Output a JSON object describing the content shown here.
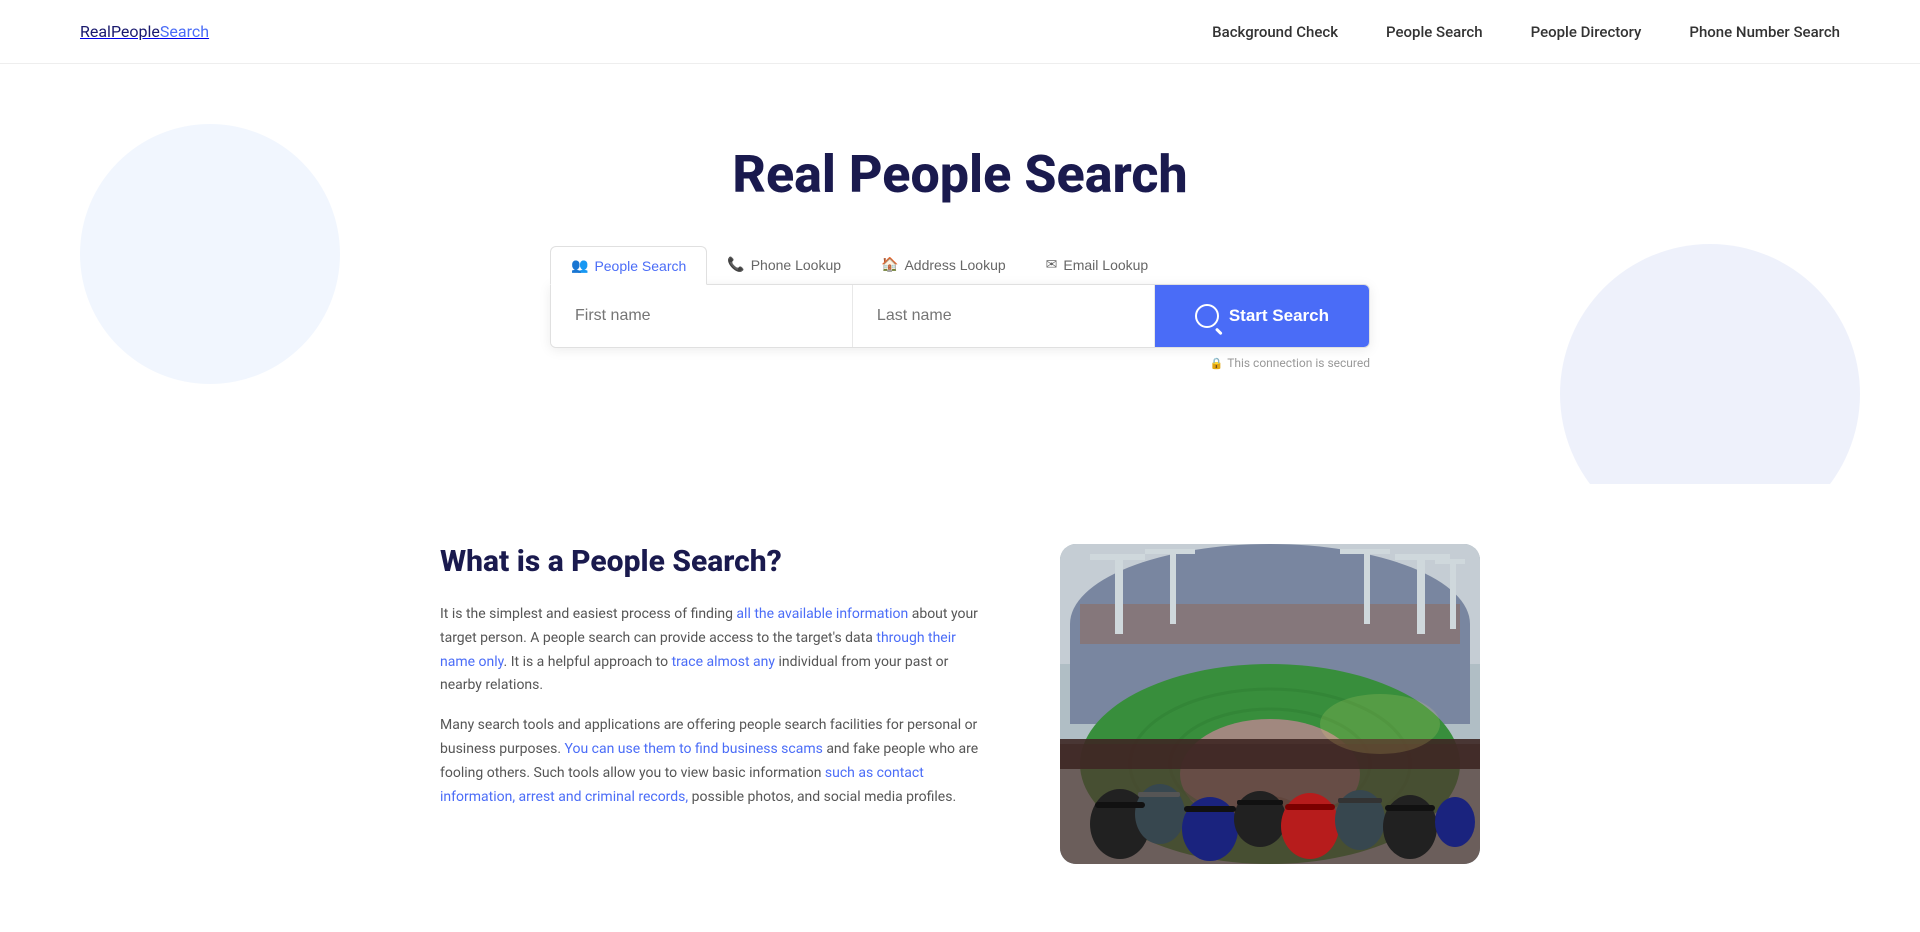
{
  "logo": {
    "text_real": "Real",
    "text_people": "People",
    "text_search": "Search",
    "full": "RealPeopleSearch"
  },
  "nav": {
    "links": [
      {
        "id": "background-check",
        "label": "Background Check"
      },
      {
        "id": "people-search",
        "label": "People Search"
      },
      {
        "id": "people-directory",
        "label": "People Directory"
      },
      {
        "id": "phone-number-search",
        "label": "Phone Number Search"
      }
    ]
  },
  "hero": {
    "title": "Real People Search"
  },
  "search_tabs": [
    {
      "id": "people-search-tab",
      "label": "People Search",
      "icon": "👥",
      "active": true
    },
    {
      "id": "phone-lookup-tab",
      "label": "Phone Lookup",
      "icon": "📞",
      "active": false
    },
    {
      "id": "address-lookup-tab",
      "label": "Address Lookup",
      "icon": "🏠",
      "active": false
    },
    {
      "id": "email-lookup-tab",
      "label": "Email Lookup",
      "icon": "✉",
      "active": false
    }
  ],
  "search": {
    "first_name_placeholder": "First name",
    "last_name_placeholder": "Last name",
    "button_label": "Start Search",
    "security_note": "This connection is secured"
  },
  "content": {
    "heading": "What is a People Search?",
    "paragraph1": "It is the simplest and easiest process of finding all the available information about your target person. A people search can provide access to the target's data through their name only. It is a helpful approach to trace almost any individual from your past or nearby relations.",
    "paragraph1_link1": "all the",
    "paragraph1_link2": "available information",
    "paragraph1_link3": "through their name only",
    "paragraph1_link4": "trace almost any",
    "paragraph2": "Many search tools and applications are offering people search facilities for personal or business purposes. You can use them to find business scams and fake people who are fooling others. Such tools allow you to view basic information such as contact information, arrest and criminal records, possible photos, and social media profiles.",
    "paragraph2_link1": "You can use them to find",
    "paragraph2_link2": "business scams",
    "paragraph2_link3": "such as contact information, arrest and criminal records,"
  }
}
